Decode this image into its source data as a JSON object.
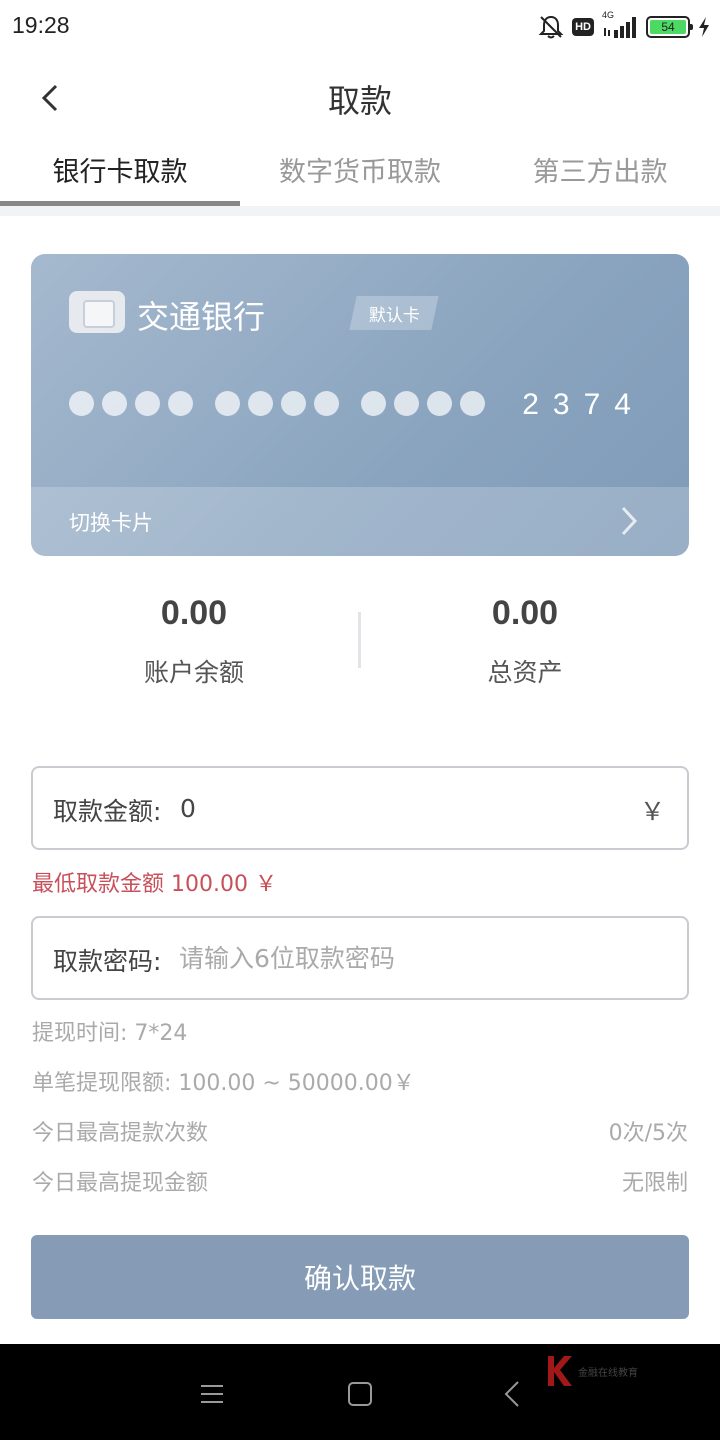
{
  "status_bar": {
    "time": "19:28",
    "hd_label": "HD",
    "network_label": "4G",
    "battery_level": "54",
    "icons": [
      "bell-off-icon",
      "hd-icon",
      "signal-icon",
      "battery-icon",
      "charging-icon"
    ]
  },
  "header": {
    "title": "取款",
    "back_icon": "chevron-left-icon"
  },
  "tabs": [
    {
      "label": "银行卡取款",
      "active": true
    },
    {
      "label": "数字货币取款",
      "active": false
    },
    {
      "label": "第三方出款",
      "active": false
    }
  ],
  "card": {
    "bank_name": "交通银行",
    "default_badge": "默认卡",
    "last_digits": "2374",
    "switch_label": "切换卡片",
    "gradient_colors": [
      "#a5b9ce",
      "#7f9bb8"
    ]
  },
  "balances": {
    "account_balance": {
      "amount": "0.00",
      "label": "账户余额"
    },
    "total_assets": {
      "amount": "0.00",
      "label": "总资产"
    }
  },
  "form": {
    "amount": {
      "label": "取款金额:",
      "value": "0",
      "currency": "￥"
    },
    "min_note": "最低取款金额 100.00 ￥",
    "password": {
      "label": "取款密码:",
      "placeholder": "请输入6位取款密码",
      "value": ""
    }
  },
  "info": {
    "time": "提现时间: 7*24",
    "single_limit": "单笔提现限额: 100.00 ~ 50000.00￥",
    "daily_count_label": "今日最高提款次数",
    "daily_count_value": "0次/5次",
    "daily_amount_label": "今日最高提现金额",
    "daily_amount_value": "无限制"
  },
  "confirm_button": "确认取款",
  "nav_bar": {
    "icons": [
      "menu-icon",
      "home-square-icon",
      "back-triangle-icon"
    ],
    "watermark_text": "金融在线教育"
  },
  "colors": {
    "accent_button": "#869cb6",
    "warning_text": "#c8505a",
    "active_tab_indicator": "#888888"
  }
}
